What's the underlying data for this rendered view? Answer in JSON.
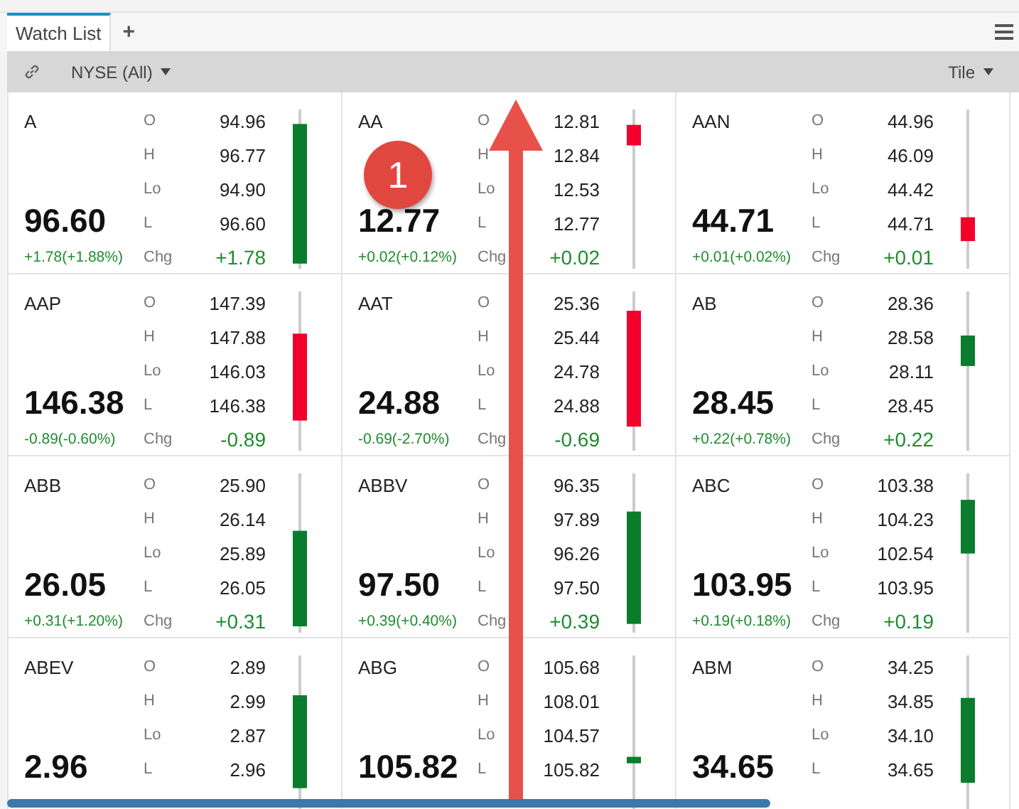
{
  "tabs": [
    {
      "label": "Watch List",
      "selected": true
    }
  ],
  "add_tab": "+",
  "toolbar": {
    "exchange": "NYSE (All)",
    "view": "Tile"
  },
  "tiles": [
    {
      "symbol": "A",
      "price": "96.60",
      "change": "+1.78(+1.88%)",
      "stats": [
        {
          "label": "O",
          "value": "94.96"
        },
        {
          "label": "H",
          "value": "96.77"
        },
        {
          "label": "Lo",
          "value": "94.90"
        },
        {
          "label": "L",
          "value": "96.60"
        }
      ],
      "chg": {
        "label": "Chg",
        "value": "+1.78"
      }
    },
    {
      "symbol": "AA",
      "price": "12.77",
      "change": "+0.02(+0.12%)",
      "stats": [
        {
          "label": "O",
          "value": "12.81"
        },
        {
          "label": "H",
          "value": "12.84"
        },
        {
          "label": "Lo",
          "value": "12.53"
        },
        {
          "label": "L",
          "value": "12.77"
        }
      ],
      "chg": {
        "label": "Chg",
        "value": "+0.02"
      }
    },
    {
      "symbol": "AAN",
      "price": "44.71",
      "change": "+0.01(+0.02%)",
      "stats": [
        {
          "label": "O",
          "value": "44.96"
        },
        {
          "label": "H",
          "value": "46.09"
        },
        {
          "label": "Lo",
          "value": "44.42"
        },
        {
          "label": "L",
          "value": "44.71"
        }
      ],
      "chg": {
        "label": "Chg",
        "value": "+0.01"
      }
    },
    {
      "symbol": "AAP",
      "price": "146.38",
      "change": "-0.89(-0.60%)",
      "stats": [
        {
          "label": "O",
          "value": "147.39"
        },
        {
          "label": "H",
          "value": "147.88"
        },
        {
          "label": "Lo",
          "value": "146.03"
        },
        {
          "label": "L",
          "value": "146.38"
        }
      ],
      "chg": {
        "label": "Chg",
        "value": "-0.89"
      }
    },
    {
      "symbol": "AAT",
      "price": "24.88",
      "change": "-0.69(-2.70%)",
      "stats": [
        {
          "label": "O",
          "value": "25.36"
        },
        {
          "label": "H",
          "value": "25.44"
        },
        {
          "label": "Lo",
          "value": "24.78"
        },
        {
          "label": "L",
          "value": "24.88"
        }
      ],
      "chg": {
        "label": "Chg",
        "value": "-0.69"
      }
    },
    {
      "symbol": "AB",
      "price": "28.45",
      "change": "+0.22(+0.78%)",
      "stats": [
        {
          "label": "O",
          "value": "28.36"
        },
        {
          "label": "H",
          "value": "28.58"
        },
        {
          "label": "Lo",
          "value": "28.11"
        },
        {
          "label": "L",
          "value": "28.45"
        }
      ],
      "chg": {
        "label": "Chg",
        "value": "+0.22"
      }
    },
    {
      "symbol": "ABB",
      "price": "26.05",
      "change": "+0.31(+1.20%)",
      "stats": [
        {
          "label": "O",
          "value": "25.90"
        },
        {
          "label": "H",
          "value": "26.14"
        },
        {
          "label": "Lo",
          "value": "25.89"
        },
        {
          "label": "L",
          "value": "26.05"
        }
      ],
      "chg": {
        "label": "Chg",
        "value": "+0.31"
      }
    },
    {
      "symbol": "ABBV",
      "price": "97.50",
      "change": "+0.39(+0.40%)",
      "stats": [
        {
          "label": "O",
          "value": "96.35"
        },
        {
          "label": "H",
          "value": "97.89"
        },
        {
          "label": "Lo",
          "value": "96.26"
        },
        {
          "label": "L",
          "value": "97.50"
        }
      ],
      "chg": {
        "label": "Chg",
        "value": "+0.39"
      }
    },
    {
      "symbol": "ABC",
      "price": "103.95",
      "change": "+0.19(+0.18%)",
      "stats": [
        {
          "label": "O",
          "value": "103.38"
        },
        {
          "label": "H",
          "value": "104.23"
        },
        {
          "label": "Lo",
          "value": "102.54"
        },
        {
          "label": "L",
          "value": "103.95"
        }
      ],
      "chg": {
        "label": "Chg",
        "value": "+0.19"
      }
    },
    {
      "symbol": "ABEV",
      "price": "2.96",
      "stats": [
        {
          "label": "O",
          "value": "2.89"
        },
        {
          "label": "H",
          "value": "2.99"
        },
        {
          "label": "Lo",
          "value": "2.87"
        },
        {
          "label": "L",
          "value": "2.96"
        }
      ]
    },
    {
      "symbol": "ABG",
      "price": "105.82",
      "stats": [
        {
          "label": "O",
          "value": "105.68"
        },
        {
          "label": "H",
          "value": "108.01"
        },
        {
          "label": "Lo",
          "value": "104.57"
        },
        {
          "label": "L",
          "value": "105.82"
        }
      ]
    },
    {
      "symbol": "ABM",
      "price": "34.65",
      "stats": [
        {
          "label": "O",
          "value": "34.25"
        },
        {
          "label": "H",
          "value": "34.85"
        },
        {
          "label": "Lo",
          "value": "34.10"
        },
        {
          "label": "L",
          "value": "34.65"
        }
      ]
    }
  ],
  "callout": {
    "number": "1"
  }
}
